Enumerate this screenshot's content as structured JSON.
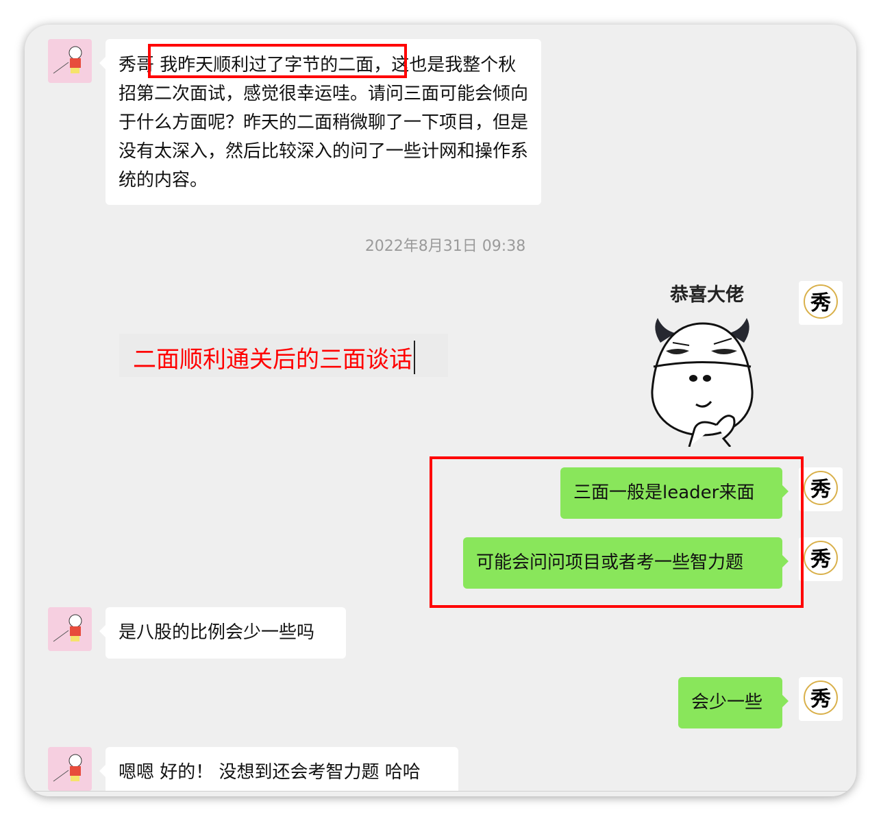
{
  "messages": [
    {
      "side": "left",
      "text": "秀哥 我昨天顺利过了字节的二面，这也是我整个秋招第二次面试，感觉很幸运哇。请问三面可能会倾向于什么方面呢？昨天的二面稍微聊了一下项目，但是没有太深入，然后比较深入的问了一些计网和操作系统的内容。"
    },
    {
      "side": "right",
      "sticker_caption": "恭喜大佬",
      "sticker": "cow-thinking-sticker"
    },
    {
      "side": "right",
      "text": "三面一般是leader来面"
    },
    {
      "side": "right",
      "text": "可能会问问项目或者考一些智力题"
    },
    {
      "side": "left",
      "text": "是八股的比例会少一些吗"
    },
    {
      "side": "right",
      "text": "会少一些"
    },
    {
      "side": "left",
      "text": "嗯嗯 好的！ 没想到还会考智力题 哈哈"
    }
  ],
  "timestamp": "2022年8月31日 09:38",
  "annotation": {
    "text": "二面顺利通关后的三面谈话",
    "color": "#ff0000"
  },
  "right_avatar_logo": "秀",
  "colors": {
    "green_bubble": "#89e65b",
    "highlight": "#ff0000",
    "background": "#efefef"
  }
}
